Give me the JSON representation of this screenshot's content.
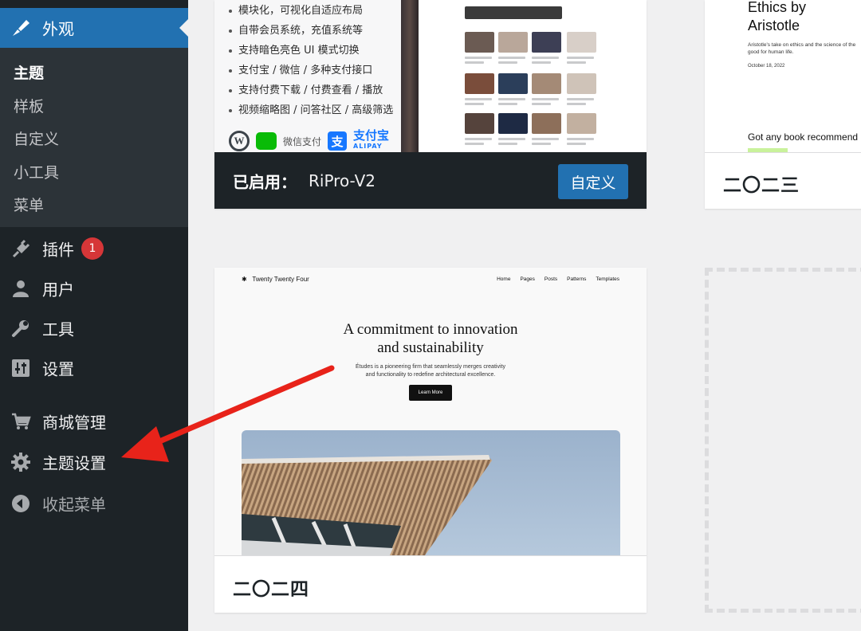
{
  "sidebar": {
    "appearance": "外观",
    "submenu": [
      {
        "label": "主题",
        "current": true
      },
      {
        "label": "样板"
      },
      {
        "label": "自定义"
      },
      {
        "label": "小工具"
      },
      {
        "label": "菜单"
      }
    ],
    "plugins": "插件",
    "plugins_badge": "1",
    "users": "用户",
    "tools": "工具",
    "settings": "设置",
    "shop": "商城管理",
    "theme_settings": "主题设置",
    "collapse": "收起菜单"
  },
  "active_theme": {
    "features": [
      "模块化，可视化自适应布局",
      "自带会员系统，充值系统等",
      "支持暗色亮色 UI 模式切换",
      "支付宝 / 微信 / 多种支付接口",
      "支持付费下载 / 付费查看 / 播放",
      "视频缩略图 / 问答社区 / 高级筛选"
    ],
    "wechat_pay": "微信支付",
    "alipay": "支付宝",
    "alipay_en": "ALIPAY",
    "active_label": "已启用：",
    "name": "RiPro-V2",
    "customize_button": "自定义"
  },
  "theme_2023": {
    "screenshot": {
      "title": "Ethics by\nAristotle",
      "body": "Aristotle's take on ethics and the science of the good for human life.",
      "date": "October 18, 2022",
      "book": "Got any book recommend"
    },
    "name": "二〇二三"
  },
  "theme_2024": {
    "screenshot": {
      "logo": "Twenty Twenty Four",
      "nav": [
        "Home",
        "Pages",
        "Posts",
        "Patterns",
        "Templates"
      ],
      "headline": "A commitment to innovation\nand sustainability",
      "subtext": "Études is a pioneering firm that seamlessly merges creativity\nand functionality to redefine architectural excellence.",
      "button": "Learn More"
    },
    "name": "二〇二四"
  },
  "colors": {
    "sidebar_bg": "#1d2327",
    "submenu_bg": "#2c3338",
    "accent": "#2271b1",
    "badge": "#d63638",
    "annotation_arrow": "#e8231a"
  },
  "annotation": {
    "points_to": "theme_settings"
  }
}
